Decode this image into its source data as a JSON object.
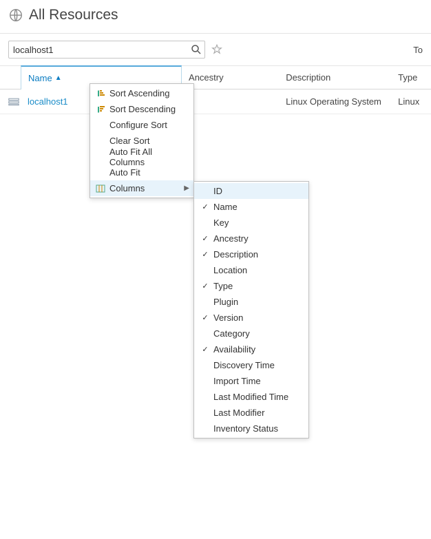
{
  "header": {
    "title": "All Resources"
  },
  "search": {
    "value": "localhost1",
    "placeholder": ""
  },
  "toolbar_right": "To",
  "columns": {
    "name": "Name",
    "ancestry": "Ancestry",
    "description": "Description",
    "type": "Type"
  },
  "rows": [
    {
      "name": "localhost1",
      "ancestry": "",
      "description": "Linux Operating System",
      "type": "Linux"
    }
  ],
  "context_menu": {
    "items": [
      {
        "label": "Sort Ascending",
        "icon": "sort-asc"
      },
      {
        "label": "Sort Descending",
        "icon": "sort-desc"
      },
      {
        "label": "Configure Sort",
        "icon": ""
      },
      {
        "label": "Clear Sort",
        "icon": ""
      },
      {
        "label": "Auto Fit All Columns",
        "icon": ""
      },
      {
        "label": "Auto Fit",
        "icon": ""
      },
      {
        "label": "Columns",
        "icon": "columns",
        "submenu": true,
        "highlighted": true
      }
    ]
  },
  "columns_submenu": {
    "items": [
      {
        "label": "ID",
        "checked": false,
        "highlighted": true
      },
      {
        "label": "Name",
        "checked": true
      },
      {
        "label": "Key",
        "checked": false
      },
      {
        "label": "Ancestry",
        "checked": true
      },
      {
        "label": "Description",
        "checked": true
      },
      {
        "label": "Location",
        "checked": false
      },
      {
        "label": "Type",
        "checked": true
      },
      {
        "label": "Plugin",
        "checked": false
      },
      {
        "label": "Version",
        "checked": true
      },
      {
        "label": "Category",
        "checked": false
      },
      {
        "label": "Availability",
        "checked": true
      },
      {
        "label": "Discovery Time",
        "checked": false
      },
      {
        "label": "Import Time",
        "checked": false
      },
      {
        "label": "Last Modified Time",
        "checked": false
      },
      {
        "label": "Last Modifier",
        "checked": false
      },
      {
        "label": "Inventory Status",
        "checked": false
      }
    ]
  }
}
